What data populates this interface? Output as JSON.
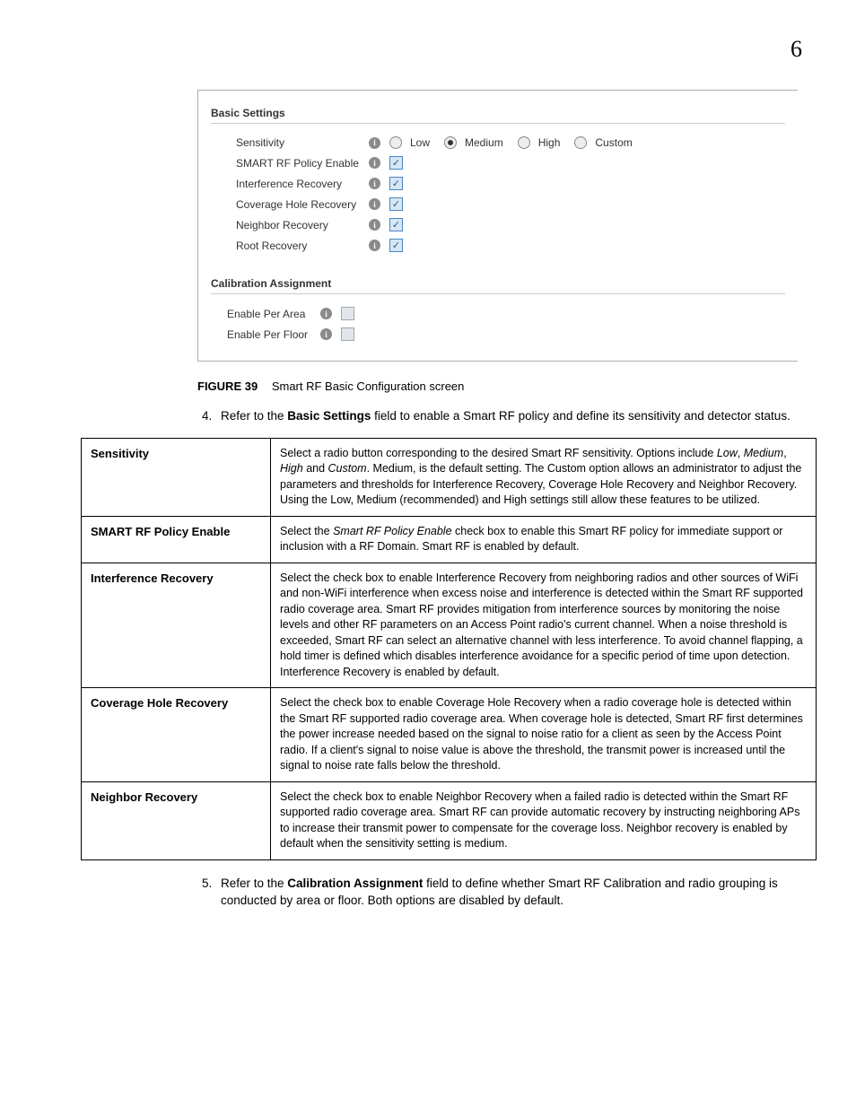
{
  "page_number": "6",
  "panel": {
    "basic_settings_title": "Basic Settings",
    "rows": {
      "sensitivity_label": "Sensitivity",
      "smart_rf_label": "SMART RF Policy Enable",
      "interference_label": "Interference Recovery",
      "coverage_label": "Coverage Hole Recovery",
      "neighbor_label": "Neighbor Recovery",
      "root_label": "Root Recovery"
    },
    "sensitivity_options": {
      "low": "Low",
      "medium": "Medium",
      "high": "High",
      "custom": "Custom"
    },
    "calibration_title": "Calibration Assignment",
    "calibration_rows": {
      "per_area": "Enable Per Area",
      "per_floor": "Enable Per Floor"
    }
  },
  "figure": {
    "number": "FIGURE 39",
    "caption": "Smart RF Basic Configuration screen"
  },
  "step4": {
    "prefix": "Refer to the ",
    "bold": "Basic Settings",
    "suffix": " field to enable a Smart RF policy and define its sensitivity and detector status."
  },
  "table": {
    "r1": {
      "term": "Sensitivity",
      "desc_a": "Select a radio button corresponding to the desired Smart RF sensitivity. Options include ",
      "low": "Low",
      "sep1": ", ",
      "medium": "Medium",
      "sep2": ", ",
      "high": "High",
      "and": " and ",
      "custom": "Custom",
      "desc_b": ". Medium, is the default setting. The Custom option allows an administrator to adjust the parameters and thresholds for Interference Recovery, Coverage Hole Recovery and Neighbor Recovery. Using the Low, Medium (recommended) and High settings still allow these features to be utilized."
    },
    "r2": {
      "term": "SMART RF Policy Enable",
      "desc_a": "Select the ",
      "ital": "Smart RF Policy Enable",
      "desc_b": " check box to enable this Smart RF policy for immediate support or inclusion with a RF Domain. Smart RF is enabled by default."
    },
    "r3": {
      "term": "Interference Recovery",
      "desc": "Select the check box to enable Interference Recovery from neighboring radios and other sources of WiFi and non-WiFi interference when excess noise and interference is detected within the Smart RF supported radio coverage area. Smart RF provides mitigation from interference sources by monitoring the noise levels and other RF parameters on an Access Point radio's current channel. When a noise threshold is exceeded, Smart RF can select an alternative channel with less interference. To avoid channel flapping, a hold timer is defined which disables interference avoidance for a specific period of time upon detection. Interference Recovery is enabled by default."
    },
    "r4": {
      "term": "Coverage Hole Recovery",
      "desc": "Select the check box to enable Coverage Hole Recovery when a radio coverage hole is detected within the Smart RF supported radio coverage area. When coverage hole is detected, Smart RF first determines the power increase needed based on the signal to noise ratio for a client as seen by the Access Point radio. If a client's signal to noise value is above the threshold, the transmit power is increased until the signal to noise rate falls below the threshold."
    },
    "r5": {
      "term": "Neighbor Recovery",
      "desc": "Select the check box to enable Neighbor Recovery when a failed radio is detected within the Smart RF supported radio coverage area. Smart RF can provide automatic recovery by instructing neighboring APs to increase their transmit power to compensate for the coverage loss. Neighbor recovery is enabled by default when the sensitivity setting is medium."
    }
  },
  "step5": {
    "prefix": "Refer to the ",
    "bold": "Calibration Assignment",
    "suffix": " field to define whether Smart RF Calibration and radio grouping is conducted by area or floor. Both options are disabled by default."
  }
}
